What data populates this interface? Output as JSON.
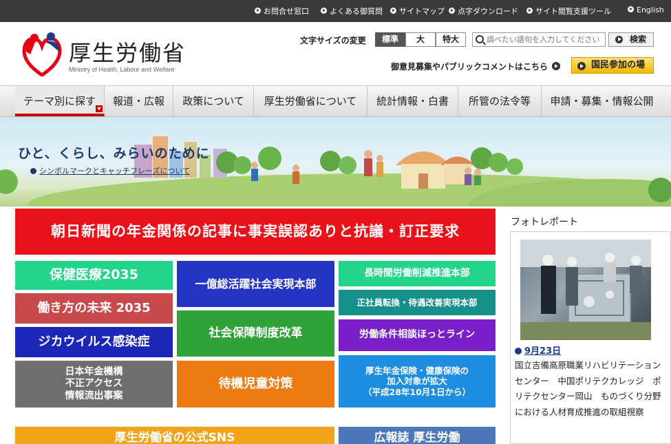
{
  "topbar": {
    "links": [
      "お問合せ窓口",
      "よくある御質問",
      "サイトマップ",
      "点字ダウンロード",
      "サイト閲覧支援ツール",
      "English"
    ]
  },
  "header": {
    "logo_title": "厚生労働省",
    "logo_sub": "Ministry of Health, Labour and Welfare",
    "font_size_label": "文字サイズの変更",
    "font_size_options": [
      "標準",
      "大",
      "特大"
    ],
    "search_placeholder": "調べたい語句を入力してください",
    "search_button": "検索",
    "comment_link": "御意見募集やパブリックコメントはこちら",
    "participation_button": "国民参加の場"
  },
  "nav": {
    "items": [
      "テーマ別に探す",
      "報道・広報",
      "政策について",
      "厚生労働省について",
      "統計情報・白書",
      "所管の法令等",
      "申請・募集・情報公開"
    ]
  },
  "hero": {
    "catch": "ひと、くらし、みらいのために",
    "link": "シンボルマークとキャッチフレーズについて"
  },
  "main": {
    "news_headline": "朝日新聞の年金関係の記事に事実誤認ありと抗議・訂正要求",
    "tiles": [
      {
        "label": "保健医療2035",
        "color": "#22d58b"
      },
      {
        "label": "働き方の未来 2035",
        "color": "#c94a4a"
      },
      {
        "label": "ジカウイルス感染症",
        "color": "#1c27b8"
      },
      {
        "label": "日本年金機構\n不正アクセス\n情報流出事案",
        "color": "#6e6e6e"
      },
      {
        "label": "一億総活躍社会実現本部",
        "color": "#2434c4"
      },
      {
        "label": "社会保障制度改革",
        "color": "#2fa33a"
      },
      {
        "label": "待機児童対策",
        "color": "#ee7a12"
      },
      {
        "label": "長時間労働削減推進本部",
        "color": "#22d58b"
      },
      {
        "label": "正社員転換・待遇改善実現本部",
        "color": "#148f8a"
      },
      {
        "label": "労働条件相談ほっとライン",
        "color": "#7a1fc8"
      },
      {
        "label": "厚生年金保険・健康保険の\n加入対象が拡大\n（平成28年10月1日から）",
        "color": "#1e8ee0"
      }
    ],
    "bottom_left": "厚生労働省の公式SNS",
    "bottom_right": "広報誌 厚生労働"
  },
  "photo_report": {
    "heading": "フォトレポート",
    "date": "9月23日",
    "text": "国立吉備高原職業リハビリテーションセンター　中国ポリテクカレッジ　ポリテクセンター岡山　ものづくり分野における人材育成推進の取組視察"
  },
  "colors": {
    "topbar": "#3a3a3a",
    "accent_red": "#e8121a",
    "link_blue": "#1a3a8a"
  }
}
